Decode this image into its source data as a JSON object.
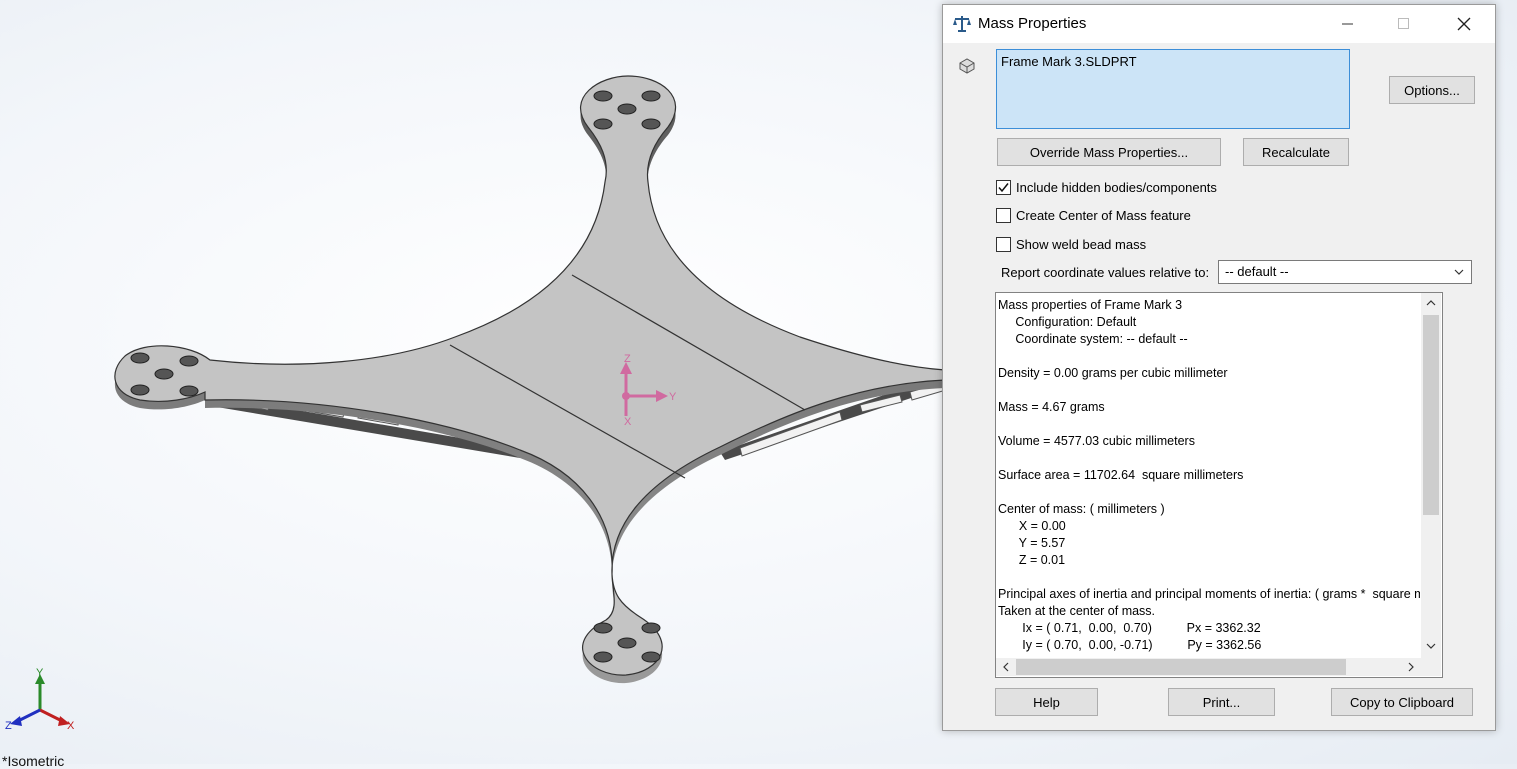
{
  "viewport": {
    "view_label": "*Isometric",
    "triad": {
      "x": "X",
      "y": "Y",
      "z": "Z"
    },
    "origin": {
      "x": "Y",
      "y": "Z",
      "z": "X"
    }
  },
  "dialog": {
    "title": "Mass Properties",
    "title_icon": "balance-scale-icon",
    "window_controls": [
      "minimize-icon",
      "maximize-icon",
      "close-icon"
    ],
    "selection": "Frame Mark 3.SLDPRT",
    "options_label": "Options...",
    "override_label": "Override Mass Properties...",
    "recalculate_label": "Recalculate",
    "checkboxes": [
      {
        "label": "Include hidden bodies/components",
        "checked": true
      },
      {
        "label": "Create Center of Mass feature",
        "checked": false
      },
      {
        "label": "Show weld bead mass",
        "checked": false
      }
    ],
    "report_label": "Report coordinate values relative to:",
    "coordinate_system": "-- default --",
    "results_lines": [
      "Mass properties of Frame Mark 3",
      "     Configuration: Default",
      "     Coordinate system: -- default --",
      "",
      "Density = 0.00 grams per cubic millimeter",
      "",
      "Mass = 4.67 grams",
      "",
      "Volume = 4577.03 cubic millimeters",
      "",
      "Surface area = 11702.64  square millimeters",
      "",
      "Center of mass: ( millimeters )",
      "      X = 0.00",
      "      Y = 5.57",
      "      Z = 0.01",
      "",
      "Principal axes of inertia and principal moments of inertia: ( grams *  square millimeters )",
      "Taken at the center of mass.",
      "       Ix = ( 0.71,  0.00,  0.70)          Px = 3362.32",
      "       Iy = ( 0.70,  0.00, -0.71)          Py = 3362.56"
    ],
    "help_label": "Help",
    "print_label": "Print...",
    "copy_label": "Copy to Clipboard"
  }
}
